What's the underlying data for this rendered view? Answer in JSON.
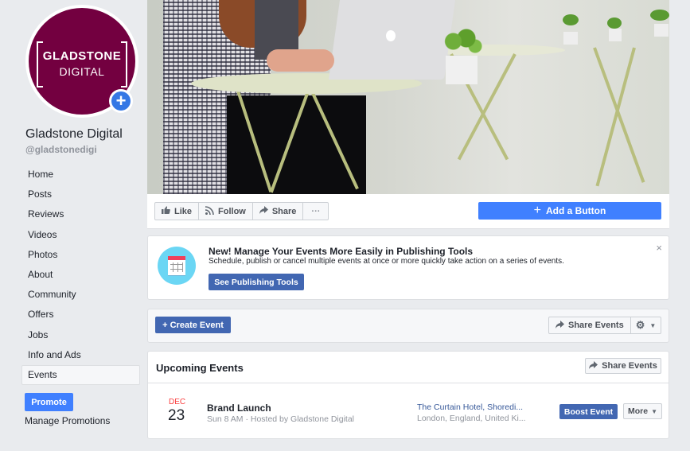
{
  "page": {
    "name": "Gladstone Digital",
    "handle": "@gladstonedigi",
    "logo": {
      "line1": "GLADSTONE",
      "line2": "DIGITAL",
      "color": "#730040"
    },
    "avatar_add_icon": "+"
  },
  "sidebar": {
    "items": [
      {
        "label": "Home"
      },
      {
        "label": "Posts"
      },
      {
        "label": "Reviews"
      },
      {
        "label": "Videos"
      },
      {
        "label": "Photos"
      },
      {
        "label": "About"
      },
      {
        "label": "Community"
      },
      {
        "label": "Offers"
      },
      {
        "label": "Jobs"
      },
      {
        "label": "Info and Ads"
      },
      {
        "label": "Events",
        "active": true
      }
    ],
    "promote_label": "Promote",
    "manage_promotions_label": "Manage Promotions"
  },
  "actions": {
    "like": {
      "icon": "thumbs-up-icon",
      "label": "Like"
    },
    "follow": {
      "icon": "rss-icon",
      "label": "Follow"
    },
    "share": {
      "icon": "share-arrow-icon",
      "label": "Share"
    },
    "more": {
      "icon": "more-dots-icon",
      "label": "···"
    },
    "add_button": {
      "icon": "+",
      "label": "Add a Button"
    }
  },
  "banner": {
    "title": "New! Manage Your Events More Easily in Publishing Tools",
    "description": "Schedule, publish or cancel multiple events at once or more quickly take action on a series of events.",
    "cta": "See Publishing Tools",
    "close": "×"
  },
  "toolbar": {
    "create_event": "+ Create Event",
    "share_events": "Share Events",
    "settings_icon": "⚙"
  },
  "upcoming": {
    "title": "Upcoming Events",
    "share_events": "Share Events",
    "events": [
      {
        "month": "DEC",
        "day": "23",
        "title": "Brand Launch",
        "meta": "Sun 8 AM · Hosted by Gladstone Digital",
        "location_line1": "The Curtain Hotel, Shoredi...",
        "location_line2": "London, England, United Ki...",
        "boost_label": "Boost Event",
        "more_label": "More"
      }
    ]
  },
  "colors": {
    "accent_blue": "#4080ff",
    "fb_blue": "#4267b2",
    "date_red": "#fa3e3e",
    "link_blue": "#365899"
  }
}
